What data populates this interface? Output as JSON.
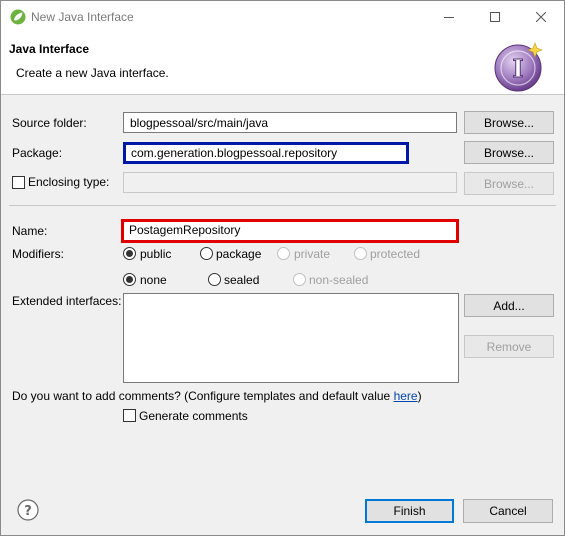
{
  "window": {
    "title": "New Java Interface",
    "minimize_icon": "minimize-icon",
    "maximize_icon": "maximize-icon",
    "close_icon": "close-icon"
  },
  "banner": {
    "title": "Java Interface",
    "description": "Create a new Java interface.",
    "icon": "interface-wizard-icon"
  },
  "source_folder": {
    "label": "Source folder:",
    "value": "blogpessoal/src/main/java",
    "button": "Browse..."
  },
  "package": {
    "label": "Package:",
    "value": "com.generation.blogpessoal.repository",
    "button": "Browse..."
  },
  "enclosing_type": {
    "label": "Enclosing type:",
    "value": "",
    "button": "Browse...",
    "checked": false
  },
  "name": {
    "label": "Name:",
    "value": "PostagemRepository"
  },
  "modifiers": {
    "label": "Modifiers:",
    "access": [
      {
        "label": "public",
        "checked": true,
        "enabled": true
      },
      {
        "label": "package",
        "checked": false,
        "enabled": true
      },
      {
        "label": "private",
        "checked": false,
        "enabled": false
      },
      {
        "label": "protected",
        "checked": false,
        "enabled": false
      }
    ],
    "sealing": [
      {
        "label": "none",
        "checked": true,
        "enabled": true
      },
      {
        "label": "sealed",
        "checked": false,
        "enabled": true
      },
      {
        "label": "non-sealed",
        "checked": false,
        "enabled": false
      }
    ]
  },
  "extended_interfaces": {
    "label": "Extended interfaces:",
    "add_button": "Add...",
    "remove_button": "Remove"
  },
  "comments": {
    "question": "Do you want to add comments? (Configure templates and default value ",
    "link": "here",
    "suffix": ")",
    "checkbox_label": "Generate comments",
    "checked": false
  },
  "footer": {
    "finish": "Finish",
    "cancel": "Cancel",
    "help_icon": "help-icon"
  },
  "colors": {
    "highlight_package": "#0018a8",
    "highlight_name": "#e00000"
  }
}
